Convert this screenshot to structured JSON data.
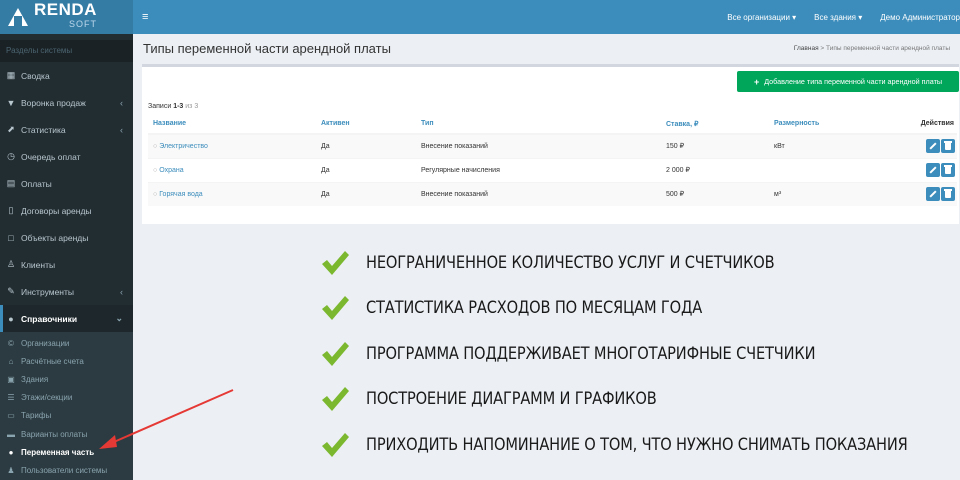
{
  "logo": {
    "main": "RENDA",
    "sub": "SOFT"
  },
  "sidebar": {
    "header": "Разделы системы",
    "items": [
      {
        "label": "Сводка",
        "icon": "calendar-icon",
        "glyph": "▦",
        "chevron": false
      },
      {
        "label": "Воронка продаж",
        "icon": "filter-icon",
        "glyph": "▼",
        "chevron": true
      },
      {
        "label": "Статистика",
        "icon": "chart-icon",
        "glyph": "⬈",
        "chevron": true
      },
      {
        "label": "Очередь оплат",
        "icon": "clock-icon",
        "glyph": "◷",
        "chevron": false
      },
      {
        "label": "Оплаты",
        "icon": "calculator-icon",
        "glyph": "▤",
        "chevron": false
      },
      {
        "label": "Договоры аренды",
        "icon": "document-icon",
        "glyph": "▯",
        "chevron": false
      },
      {
        "label": "Объекты аренды",
        "icon": "square-icon",
        "glyph": "□",
        "chevron": false
      },
      {
        "label": "Клиенты",
        "icon": "user-icon",
        "glyph": "♙",
        "chevron": false
      },
      {
        "label": "Инструменты",
        "icon": "wrench-icon",
        "glyph": "✎",
        "chevron": true
      }
    ],
    "active": {
      "label": "Справочники",
      "icon": "info-icon",
      "glyph": "●"
    },
    "subitems": [
      {
        "label": "Организации",
        "icon": "copyright-icon",
        "glyph": "©"
      },
      {
        "label": "Расчётные счета",
        "icon": "bank-icon",
        "glyph": "⌂"
      },
      {
        "label": "Здания",
        "icon": "building-icon",
        "glyph": "▣"
      },
      {
        "label": "Этажи/секции",
        "icon": "list-icon",
        "glyph": "☰"
      },
      {
        "label": "Тарифы",
        "icon": "money-icon",
        "glyph": "▭"
      },
      {
        "label": "Варианты оплаты",
        "icon": "card-icon",
        "glyph": "▬"
      },
      {
        "label": "Переменная часть",
        "icon": "marker-icon",
        "glyph": "●",
        "current": true
      },
      {
        "label": "Пользователи системы",
        "icon": "users-icon",
        "glyph": "♟"
      }
    ]
  },
  "topbar": {
    "menu_glyph": "≡",
    "org_select": "Все организации ▾",
    "building_select": "Все здания ▾",
    "user": "Демо Администратор"
  },
  "page": {
    "title": "Типы переменной части арендной платы",
    "crumb_home": "Главная",
    "crumb_sep": ">",
    "crumb_current": "Типы переменной части арендной платы"
  },
  "box": {
    "add_button": "Добавление типа переменной части арендной платы",
    "records_label": "Записи",
    "records_range": "1-3",
    "records_total": "из 3"
  },
  "table": {
    "headers": [
      "Название",
      "Активен",
      "Тип",
      "Ставка, ₽",
      "Размерность",
      "Действия"
    ],
    "rows": [
      {
        "name": "Электричество",
        "active": "Да",
        "type": "Внесение показаний",
        "rate": "150 ₽",
        "unit": "кВт"
      },
      {
        "name": "Охрана",
        "active": "Да",
        "type": "Регулярные начисления",
        "rate": "2 000 ₽",
        "unit": ""
      },
      {
        "name": "Горячая вода",
        "active": "Да",
        "type": "Внесение показаний",
        "rate": "500 ₽",
        "unit": "м³"
      }
    ]
  },
  "features": [
    "НЕОГРАНИЧЕННОЕ КОЛИЧЕСТВО УСЛУГ И СЧЕТЧИКОВ",
    "СТАТИСТИКА РАСХОДОВ ПО МЕСЯЦАМ ГОДА",
    "ПРОГРАММА ПОДДЕРЖИВАЕТ МНОГОТАРИФНЫЕ СЧЕТЧИКИ",
    "ПОСТРОЕНИЕ ДИАГРАММ И ГРАФИКОВ",
    "ПРИХОДИТЬ НАПОМИНАНИЕ О ТОМ, ЧТО НУЖНО СНИМАТЬ ПОКАЗАНИЯ"
  ],
  "colors": {
    "sidebar_bg": "#222d32",
    "topbar_bg": "#3c8dbc",
    "accent_green": "#00a65a",
    "check_green": "#7cb82f",
    "arrow_red": "#e53935"
  }
}
